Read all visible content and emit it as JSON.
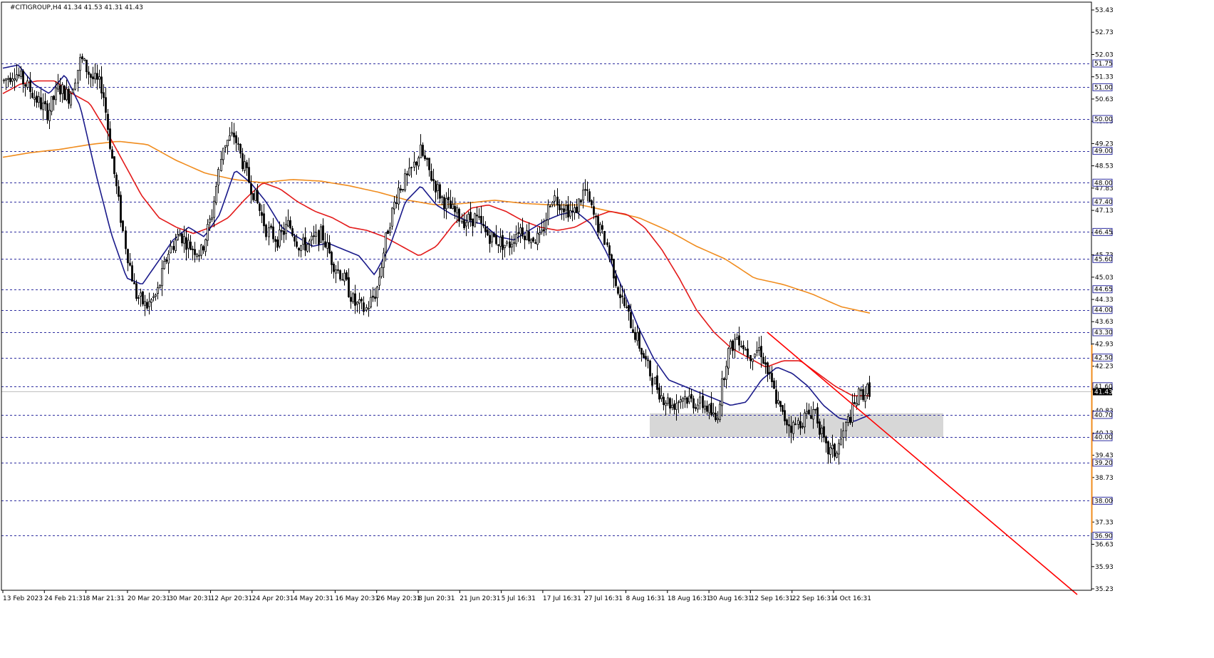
{
  "chart_data": {
    "type": "candlestick",
    "title": "#CITIGROUP,H4  41.34 41.53 41.31 41.43",
    "ohlc_last": {
      "open": 41.34,
      "high": 41.53,
      "low": 41.31,
      "close": 41.43
    },
    "current_price": "41.43",
    "ylim": [
      35.0,
      53.6
    ],
    "y_ticks": [
      "53.43",
      "52.73",
      "52.03",
      "51.33",
      "50.63",
      "49.93",
      "49.23",
      "48.53",
      "47.83",
      "47.13",
      "46.43",
      "45.73",
      "45.03",
      "44.33",
      "43.63",
      "42.93",
      "42.23",
      "41.53",
      "40.83",
      "40.13",
      "39.43",
      "38.73",
      "38.03",
      "37.33",
      "36.63",
      "35.93",
      "35.23"
    ],
    "levels": [
      51.75,
      51.0,
      50.0,
      49.0,
      48.0,
      47.4,
      46.45,
      45.6,
      44.65,
      44.0,
      43.3,
      42.5,
      41.6,
      40.7,
      40.0,
      39.2,
      38.0,
      36.9
    ],
    "level_labels": [
      "51.75",
      "51.00",
      "50.00",
      "49.00",
      "48.00",
      "47.40",
      "46.45",
      "45.60",
      "44.65",
      "44.00",
      "43.30",
      "42.50",
      "41.60",
      "40.70",
      "40.00",
      "39.20",
      "38.00",
      "36.90"
    ],
    "x_labels": [
      "13 Feb 2023",
      "24 Feb 21:31",
      "8 Mar 21:31",
      "20 Mar 20:31",
      "30 Mar 20:31",
      "12 Apr 20:31",
      "24 Apr 20:31",
      "4 May 20:31",
      "16 May 20:31",
      "26 May 20:31",
      "8 Jun 20:31",
      "21 Jun 20:31",
      "5 Jul 16:31",
      "17 Jul 16:31",
      "27 Jul 16:31",
      "8 Aug 16:31",
      "18 Aug 16:31",
      "30 Aug 16:31",
      "12 Sep 16:31",
      "22 Sep 16:31",
      "4 Oct 16:31"
    ],
    "price_anchors": [
      51.2,
      51.5,
      51.1,
      50.6,
      50.2,
      51.0,
      50.7,
      51.9,
      51.3,
      51.0,
      48.5,
      46.2,
      44.5,
      44.1,
      44.5,
      45.8,
      46.4,
      46.0,
      45.8,
      47.0,
      49.2,
      49.5,
      48.4,
      47.5,
      46.5,
      46.2,
      46.7,
      46.0,
      46.1,
      46.4,
      45.5,
      45.0,
      44.2,
      44.0,
      44.6,
      46.5,
      47.8,
      48.2,
      49.0,
      48.2,
      47.5,
      47.1,
      46.8,
      46.9,
      46.4,
      46.2,
      46.0,
      46.6,
      46.3,
      46.2,
      47.6,
      47.3,
      47.0,
      47.8,
      46.8,
      46.1,
      44.7,
      43.8,
      42.9,
      42.0,
      41.3,
      41.0,
      41.3,
      41.1,
      41.0,
      40.5,
      42.6,
      43.2,
      42.6,
      42.8,
      41.7,
      40.7,
      40.3,
      40.6,
      40.9,
      39.6,
      39.5,
      40.5,
      41.3,
      41.5
    ],
    "sma_blue_anchors": [
      51.6,
      51.7,
      51.1,
      50.8,
      51.4,
      50.4,
      48.3,
      46.4,
      45.0,
      44.8,
      45.5,
      46.2,
      46.6,
      46.3,
      47.0,
      48.4,
      48.0,
      47.4,
      46.6,
      46.3,
      46.0,
      46.1,
      45.9,
      45.7,
      45.1,
      46.0,
      47.4,
      47.9,
      47.3,
      47.0,
      46.8,
      46.7,
      46.3,
      46.2,
      46.5,
      46.8,
      47.0,
      47.1,
      46.7,
      45.8,
      44.7,
      43.5,
      42.5,
      41.8,
      41.6,
      41.4,
      41.2,
      41.0,
      41.1,
      41.8,
      42.2,
      42.0,
      41.6,
      41.0,
      40.6,
      40.5,
      40.7
    ],
    "sma_red_anchors": [
      50.8,
      51.1,
      51.2,
      51.2,
      50.8,
      50.5,
      49.6,
      48.6,
      47.6,
      46.9,
      46.6,
      46.4,
      46.6,
      46.9,
      47.5,
      48.0,
      47.8,
      47.4,
      47.1,
      46.9,
      46.6,
      46.5,
      46.3,
      46.0,
      45.7,
      46.0,
      46.7,
      47.2,
      47.3,
      47.1,
      46.8,
      46.6,
      46.5,
      46.6,
      46.9,
      47.1,
      47.0,
      46.6,
      45.9,
      45.0,
      44.0,
      43.3,
      42.8,
      42.5,
      42.2,
      42.4,
      42.4,
      42.0,
      41.6,
      41.3,
      41.3
    ],
    "sma_orange_anchors": [
      48.8,
      48.95,
      49.05,
      49.2,
      49.3,
      49.2,
      48.7,
      48.3,
      48.1,
      48.0,
      48.1,
      48.05,
      47.9,
      47.7,
      47.45,
      47.3,
      47.35,
      47.45,
      47.35,
      47.3,
      47.3,
      47.1,
      46.9,
      46.5,
      46.0,
      45.6,
      45.0,
      44.8,
      44.5,
      44.1,
      43.9
    ],
    "trendline": {
      "x0_label_index": 18.0,
      "price0": 43.3,
      "x1_frac": 0.986,
      "price1": 35.05
    },
    "zone": {
      "top": 40.75,
      "bottom": 40.0
    },
    "colors": {
      "candle": "#000000",
      "sma_fast": "#1a1a8a",
      "sma_mid": "#e31a1a",
      "sma_slow": "#f08c1e",
      "trendline": "#ff0000",
      "level_line": "#2f2fa0",
      "zone": "#d7d7d7",
      "axis_accent": "#f08c1e"
    }
  }
}
